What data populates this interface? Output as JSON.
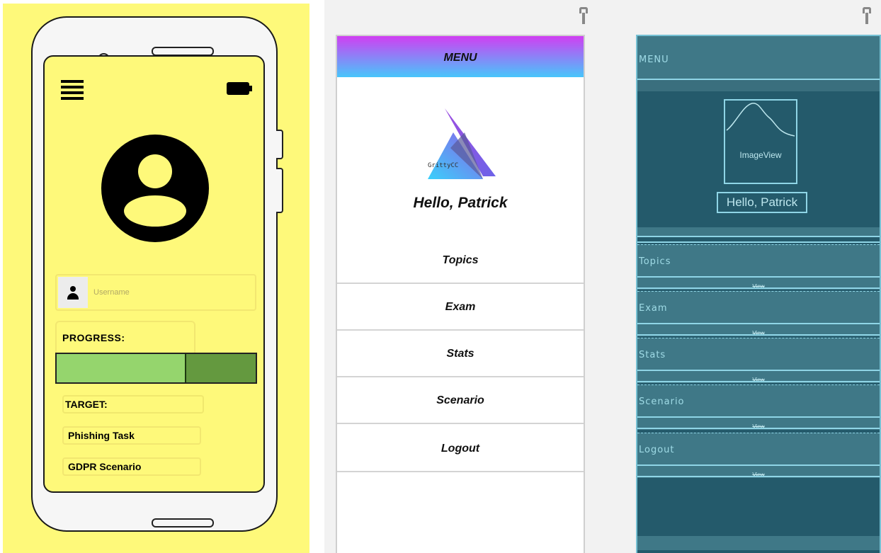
{
  "mockup": {
    "username_placeholder": "Username",
    "progress_label": "PROGRESS:",
    "progress_fraction": 0.65,
    "target_label": "TARGET:",
    "targets": [
      "Phishing Task",
      "GDPR Scenario"
    ],
    "icons": [
      "hamburger-menu-icon",
      "battery-icon",
      "profile-avatar-icon",
      "person-icon"
    ],
    "colors": {
      "background": "#fef97a",
      "progress_fill": "#95d56d",
      "progress_track": "#64993f"
    }
  },
  "design": {
    "menu_title": "MENU",
    "logo_text": "GrittyCC",
    "greeting": "Hello, Patrick",
    "items": [
      "Topics",
      "Exam",
      "Stats",
      "Scenario",
      "Logout"
    ],
    "colors": {
      "header_top": "#d03ff2",
      "header_bottom": "#47c6fb"
    }
  },
  "blueprint": {
    "menu_title": "MENU",
    "image_label": "ImageView",
    "greeting": "Hello, Patrick",
    "items": [
      "Topics",
      "Exam",
      "Stats",
      "Scenario",
      "Logout"
    ],
    "item_sublabel": "View",
    "colors": {
      "background": "#245a6b",
      "outline": "#8fd5e6"
    }
  }
}
